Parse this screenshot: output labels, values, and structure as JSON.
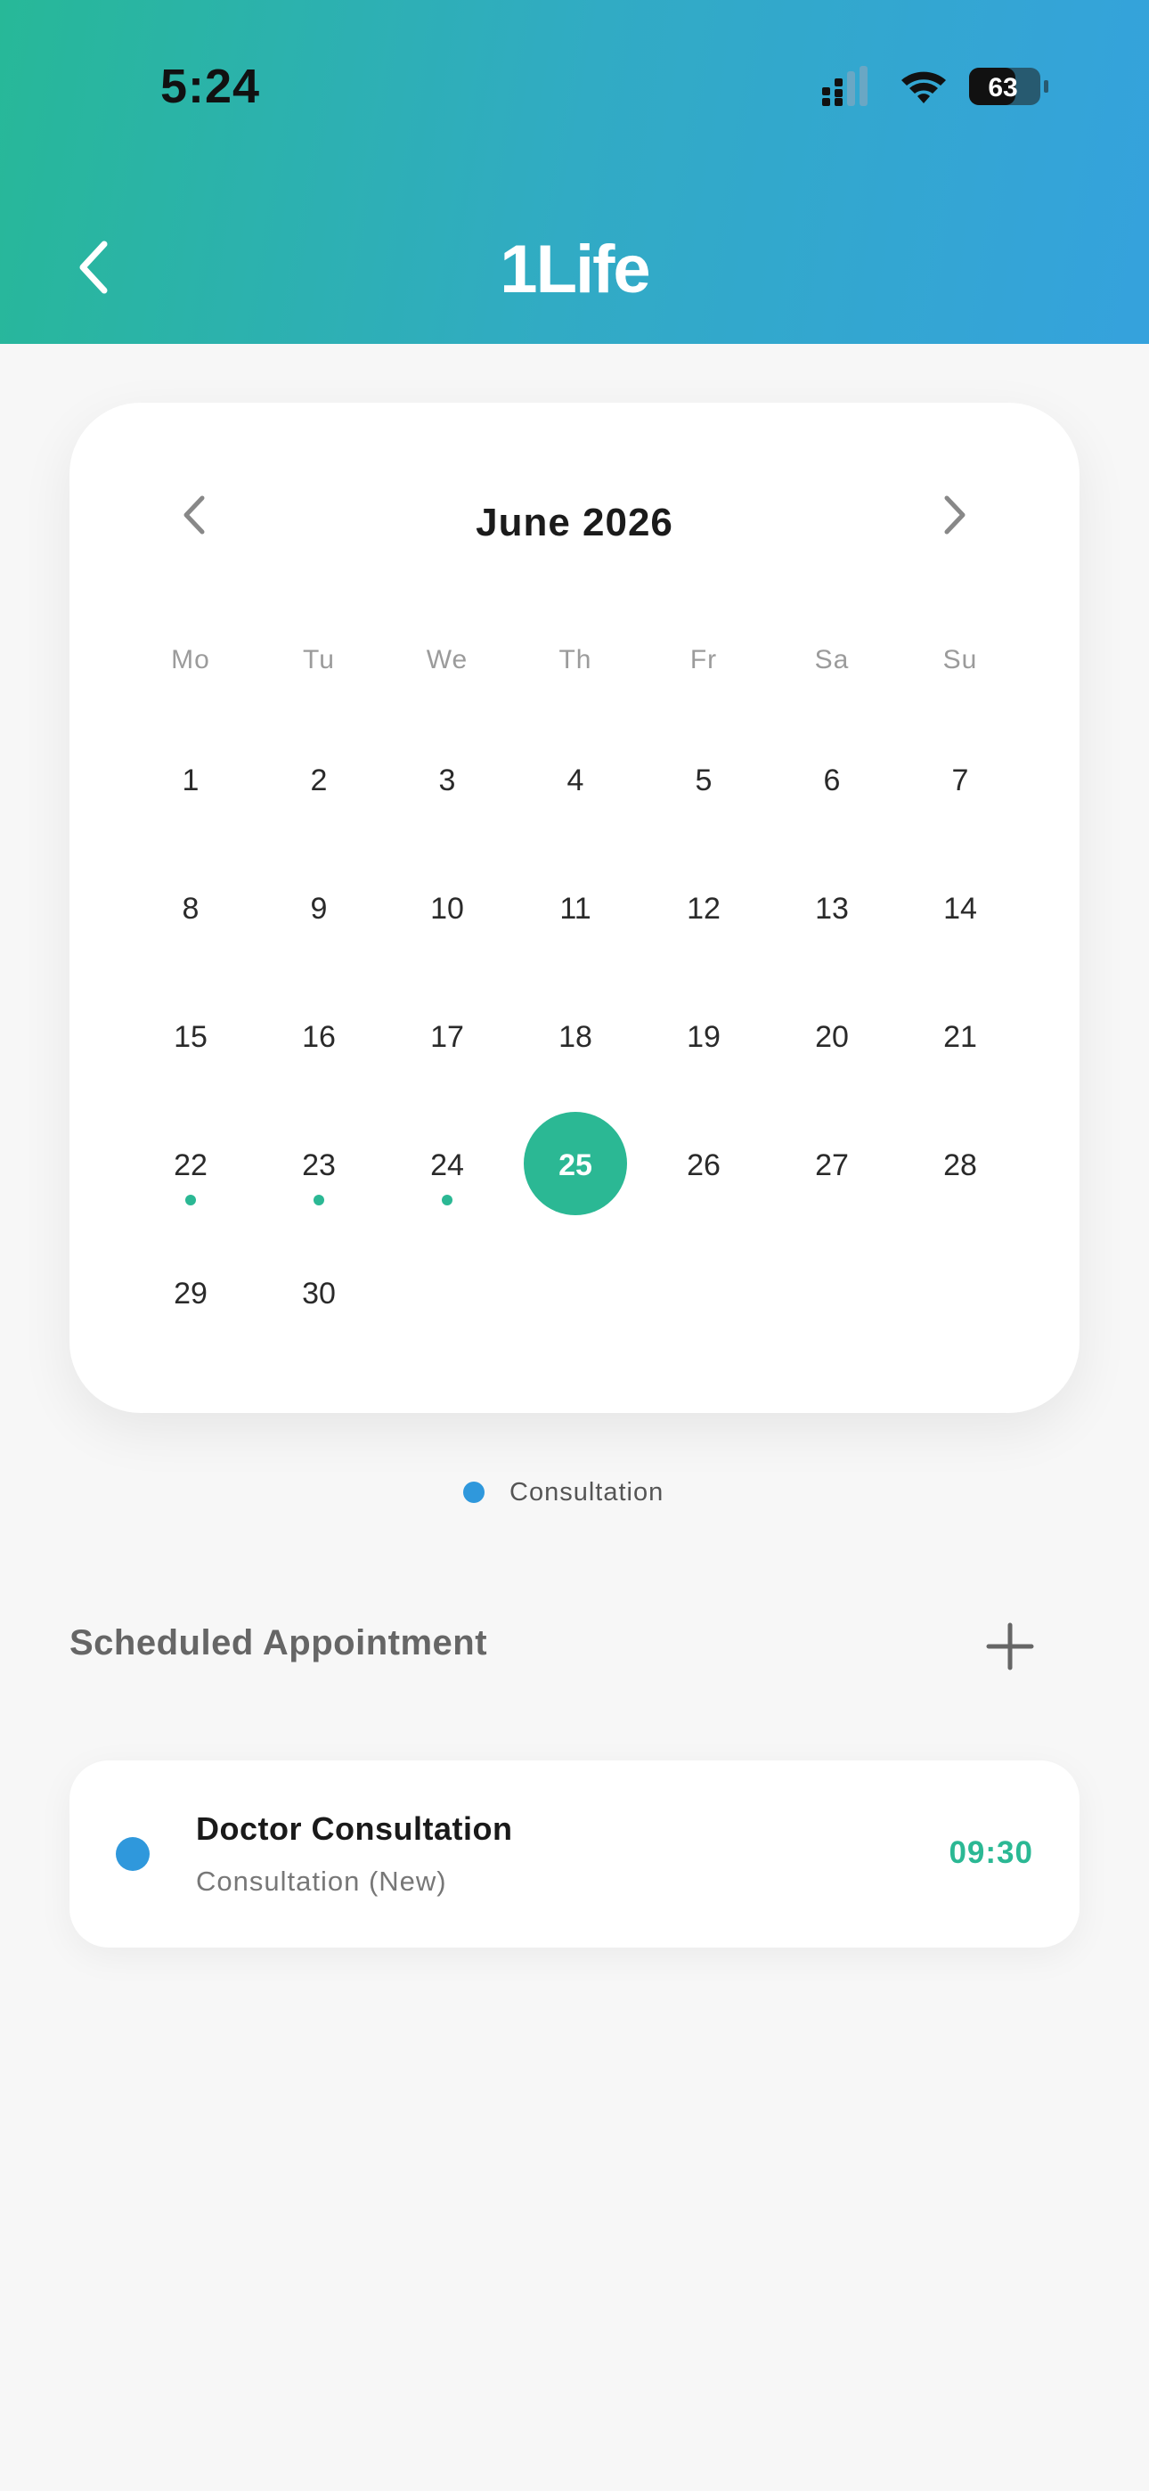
{
  "status_bar": {
    "time": "5:24",
    "battery": "63"
  },
  "header": {
    "logo_text": "1Life",
    "back_icon": "chevron-left-icon"
  },
  "calendar": {
    "month_title": "June 2026",
    "weekdays": [
      "Mo",
      "Tu",
      "We",
      "Th",
      "Fr",
      "Sa",
      "Su"
    ],
    "days": [
      "1",
      "2",
      "3",
      "4",
      "5",
      "6",
      "7",
      "8",
      "9",
      "10",
      "11",
      "12",
      "13",
      "14",
      "15",
      "16",
      "17",
      "18",
      "19",
      "20",
      "21",
      "22",
      "23",
      "24",
      "25",
      "26",
      "27",
      "28",
      "29",
      "30"
    ],
    "selected_day": "25",
    "event_days": [
      "22",
      "23",
      "24"
    ],
    "colors": {
      "accent": "#2bb894",
      "event": "#2bb894"
    }
  },
  "legend": {
    "label": "Consultation",
    "color": "#2f98dc"
  },
  "appointments_section": {
    "title": "Scheduled Appointment",
    "add_icon": "plus-icon",
    "items": [
      {
        "title": "Doctor Consultation",
        "subtitle": "Consultation (New)",
        "time": "09:30",
        "dot_color": "#2f98dc"
      }
    ]
  }
}
